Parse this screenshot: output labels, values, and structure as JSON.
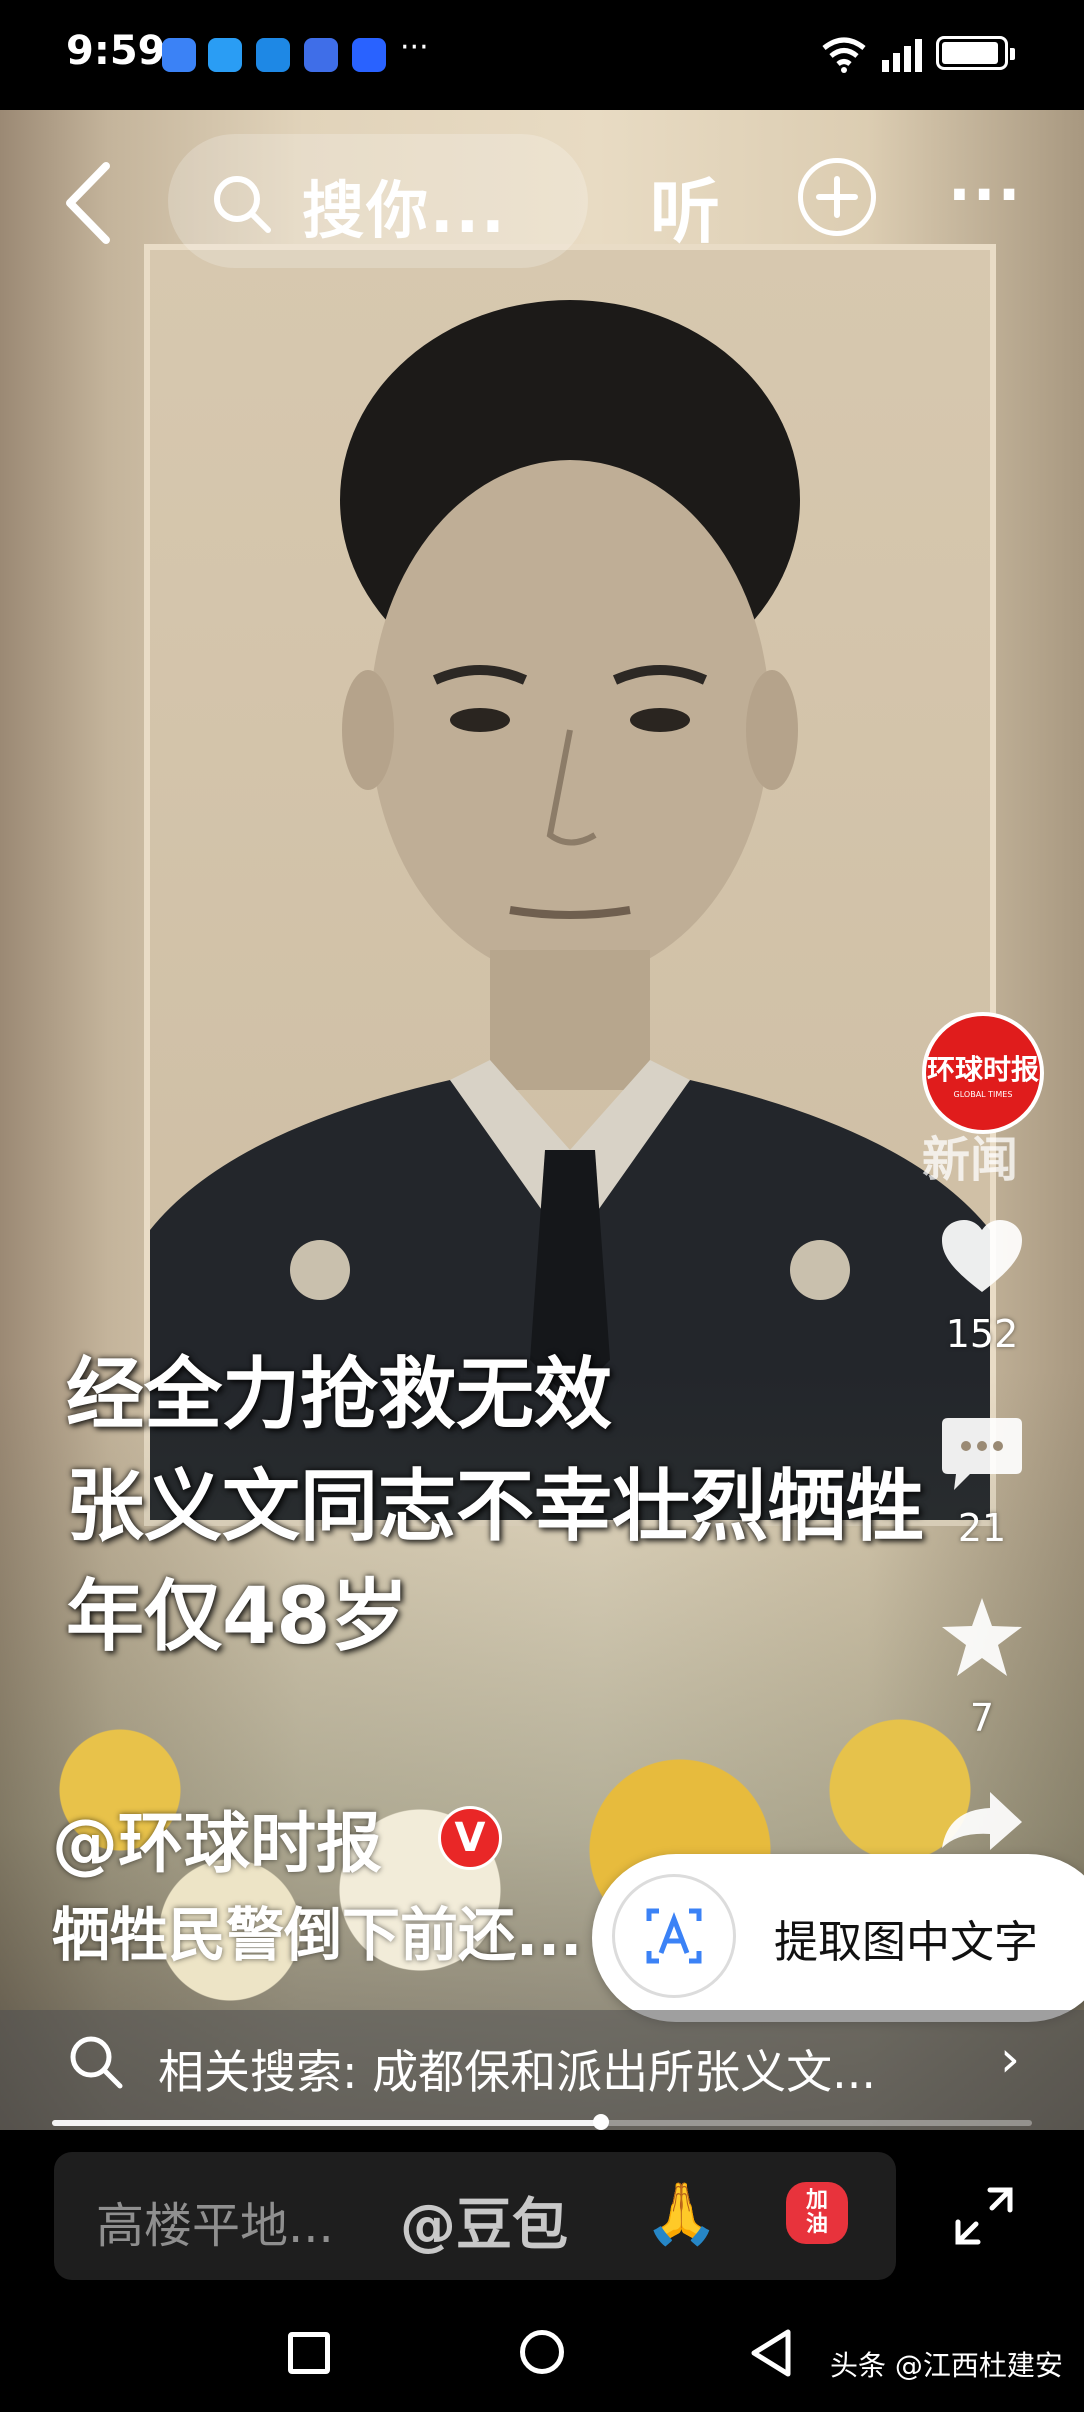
{
  "status_bar": {
    "time": "9:59",
    "notification_icons": [
      "6",
      "◆",
      "▢",
      "⊕",
      "◎"
    ],
    "more": "···"
  },
  "top_bar": {
    "search_placeholder": "搜你...",
    "listen_label": "听",
    "more": "···"
  },
  "video": {
    "caption_lines": [
      "经全力抢救无效",
      "张义文同志不幸壮烈牺牲",
      "年仅48岁"
    ],
    "watermark": "新闻"
  },
  "right_rail": {
    "avatar_logo": "环球时报",
    "avatar_sub": "GLOBAL TIMES",
    "likes": "152",
    "comments": "21",
    "favorites": "7"
  },
  "author": {
    "handle": "@环球时报",
    "verified_badge": "V"
  },
  "description": "牺牲民警倒下前还...",
  "extract_text_button": "提取图中文字",
  "related_search": {
    "label": "相关搜索:",
    "query": "成都保和派出所张义文..."
  },
  "progress": {
    "fraction": 0.56
  },
  "comment_bar": {
    "placeholder": "高楼平地...",
    "mention": "@豆包",
    "emoji_pray": "🙏",
    "emoji_jiayou_top": "加",
    "emoji_jiayou_bottom": "油"
  },
  "source_tag": "头条 @江西杜建安",
  "colors": {
    "accent_red": "#e92727",
    "background": "#000000"
  }
}
